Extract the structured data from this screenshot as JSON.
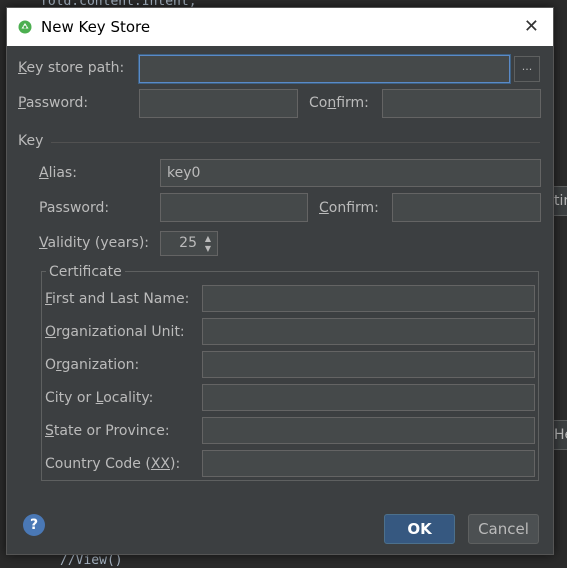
{
  "background": {
    "code_top": "fold.content.Intent;",
    "code_bottom": "//View()",
    "side_btn_1": "tin",
    "side_btn_2": "He"
  },
  "window": {
    "title": "New Key Store",
    "close_glyph": "✕"
  },
  "keystore": {
    "path_label_u": "K",
    "path_label_rest": "ey store path:",
    "path_value": "",
    "browse_label": "...",
    "password_label_u": "P",
    "password_label_rest": "assword:",
    "confirm_label_pre": "Co",
    "confirm_label_u": "n",
    "confirm_label_rest": "firm:"
  },
  "key": {
    "section_label": "Key",
    "alias_label_u": "A",
    "alias_label_rest": "lias:",
    "alias_value": "key0",
    "password_label": "Password:",
    "confirm_label_u": "C",
    "confirm_label_rest": "onfirm:",
    "validity_label_u": "V",
    "validity_label_rest": "alidity (years):",
    "validity_value": "25"
  },
  "certificate": {
    "section_label": "Certificate",
    "fields": [
      {
        "pre": "",
        "u": "F",
        "rest": "irst and Last Name:"
      },
      {
        "pre": "",
        "u": "O",
        "rest": "rganizational Unit:"
      },
      {
        "pre": "O",
        "u": "r",
        "rest": "ganization:"
      },
      {
        "pre": "City or ",
        "u": "L",
        "rest": "ocality:"
      },
      {
        "pre": "",
        "u": "S",
        "rest": "tate or Province:"
      },
      {
        "pre": "Country Code (",
        "u": "XX",
        "rest": "):"
      }
    ]
  },
  "footer": {
    "help_glyph": "?",
    "ok_label": "OK",
    "cancel_label": "Cancel"
  },
  "colors": {
    "accent": "#365880",
    "focus": "#5a8ac7",
    "dialog_bg": "#3c3f41"
  }
}
